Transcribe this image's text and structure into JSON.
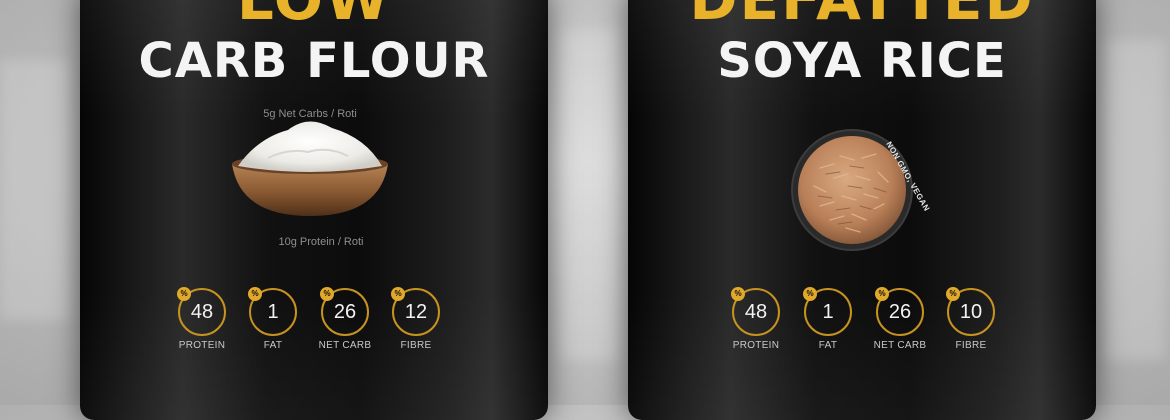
{
  "products": [
    {
      "title_top": "LOW",
      "title_main": "CARB FLOUR",
      "caption_top": "5g Net Carbs / Roti",
      "caption_bottom": "10g Protein / Roti",
      "stats": [
        {
          "value": "48",
          "label": "PROTEIN"
        },
        {
          "value": "1",
          "label": "FAT"
        },
        {
          "value": "26",
          "label": "NET CARB"
        },
        {
          "value": "12",
          "label": "FIBRE"
        }
      ]
    },
    {
      "title_top": "DEFATTED",
      "title_main": "SOYA RICE",
      "badge": "NON GMO, VEGAN",
      "stats": [
        {
          "value": "48",
          "label": "PROTEIN"
        },
        {
          "value": "1",
          "label": "FAT"
        },
        {
          "value": "26",
          "label": "NET CARB"
        },
        {
          "value": "10",
          "label": "FIBRE"
        }
      ]
    }
  ],
  "stat_badge_symbol": "%",
  "colors": {
    "gold": "#e8b32a",
    "ring": "#c79320",
    "title_white": "#f4f4f4",
    "pouch": "#111111"
  },
  "icons": {
    "flour_bowl": "bowl-of-flour-icon",
    "rice_bowl": "bowl-of-rice-icon"
  }
}
